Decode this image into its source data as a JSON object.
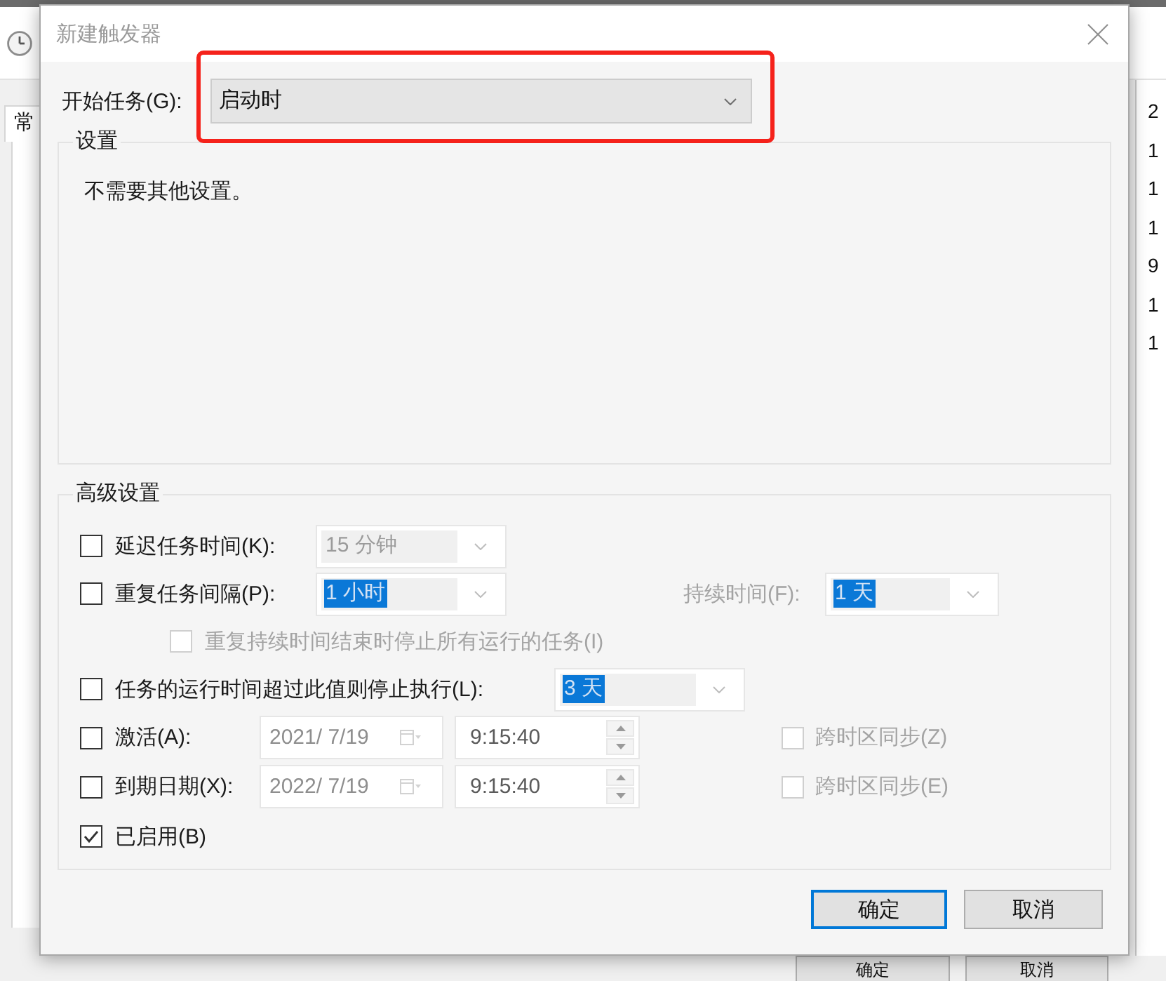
{
  "background_window": {
    "tab": "常",
    "column_cells": [
      "2",
      "1",
      "1",
      "1",
      "9",
      "1",
      "1"
    ],
    "buttons": [
      {
        "kind": "ok",
        "label": "确定"
      },
      {
        "kind": "cancel",
        "label": "取消"
      }
    ]
  },
  "dialog": {
    "title": "新建触发器"
  },
  "start_task": {
    "label": "开始任务(G):",
    "field": {
      "value": "启动时",
      "disabled": false
    },
    "annotated": true
  },
  "settings": {
    "title": "设置",
    "message": "不需要其他设置。"
  },
  "advanced": {
    "title": "高级设置",
    "rows": [
      {
        "kind": "dropdown",
        "checked": false,
        "label": "延迟任务时间(K):",
        "field": {
          "value": "15 分钟",
          "disabled": true,
          "highlighted": false
        }
      },
      {
        "kind": "dropdown",
        "checked": false,
        "label": "重复任务间隔(P):",
        "field": {
          "value": "1 小时",
          "disabled": true,
          "highlighted": true
        },
        "extra": {
          "label": "持续时间(F):",
          "disabled": true,
          "field": {
            "value": "1 天",
            "disabled": true,
            "highlighted": true
          }
        }
      },
      {
        "kind": "sub_checkbox",
        "checked": false,
        "disabled": true,
        "label": "重复持续时间结束时停止所有运行的任务(I)"
      },
      {
        "kind": "dropdown",
        "checked": false,
        "label": "任务的运行时间超过此值则停止执行(L):",
        "field": {
          "value": "3 天",
          "disabled": true,
          "highlighted": true
        }
      },
      {
        "kind": "datetime",
        "checked": false,
        "label": "激活(A):",
        "date": {
          "value": "2021/ 7/19",
          "disabled": true
        },
        "time": {
          "value": "9:15:40",
          "disabled": true
        },
        "sync": {
          "label": "跨时区同步(Z)",
          "checked": false,
          "disabled": true
        }
      },
      {
        "kind": "datetime",
        "checked": false,
        "label": "到期日期(X):",
        "date": {
          "value": "2022/ 7/19",
          "disabled": true
        },
        "time": {
          "value": "9:15:40",
          "disabled": true
        },
        "sync": {
          "label": "跨时区同步(E)",
          "checked": false,
          "disabled": true
        }
      },
      {
        "kind": "checkbox",
        "checked": true,
        "label": "已启用(B)"
      }
    ]
  },
  "buttons": [
    {
      "kind": "ok",
      "label": "确定",
      "default": true
    },
    {
      "kind": "cancel",
      "label": "取消",
      "default": false
    }
  ]
}
